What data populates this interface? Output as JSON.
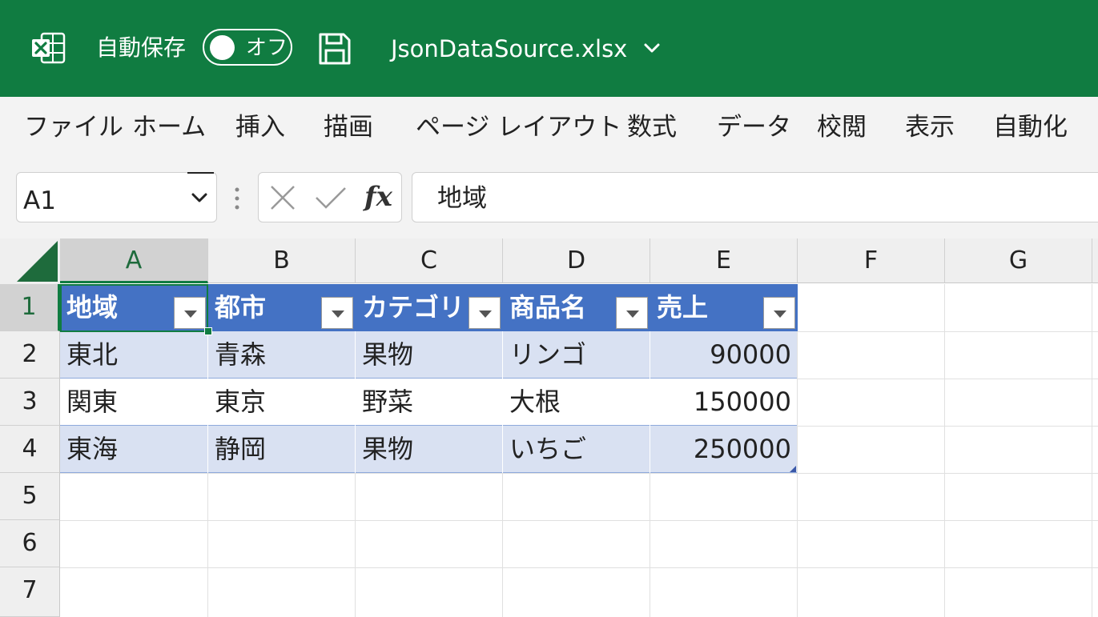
{
  "titlebar": {
    "app_icon": "excel-icon",
    "autosave_label": "自動保存",
    "autosave_state": "オフ",
    "save_icon": "save-icon",
    "filename": "JsonDataSource.xlsx",
    "brand_color": "#107c41"
  },
  "ribbon": {
    "tabs": [
      "ファイル",
      "ホーム",
      "挿入",
      "描画",
      "ページ レイアウト",
      "数式",
      "データ",
      "校閲",
      "表示",
      "自動化"
    ]
  },
  "formula_bar": {
    "name_box": "A1",
    "cancel_icon": "close-icon",
    "enter_icon": "checkmark-icon",
    "fx_label": "fx",
    "formula": "地域"
  },
  "sheet": {
    "columns": [
      "A",
      "B",
      "C",
      "D",
      "E",
      "F",
      "G"
    ],
    "rows": [
      "1",
      "2",
      "3",
      "4",
      "5",
      "6",
      "7"
    ],
    "active_cell": "A1",
    "table": {
      "header_color": "#4472c4",
      "band_color": "#d9e1f2",
      "headers": [
        "地域",
        "都市",
        "カテゴリ",
        "商品名",
        "売上"
      ],
      "rows": [
        [
          "東北",
          "青森",
          "果物",
          "リンゴ",
          "90000"
        ],
        [
          "関東",
          "東京",
          "野菜",
          "大根",
          "150000"
        ],
        [
          "東海",
          "静岡",
          "果物",
          "いちご",
          "250000"
        ]
      ]
    }
  }
}
